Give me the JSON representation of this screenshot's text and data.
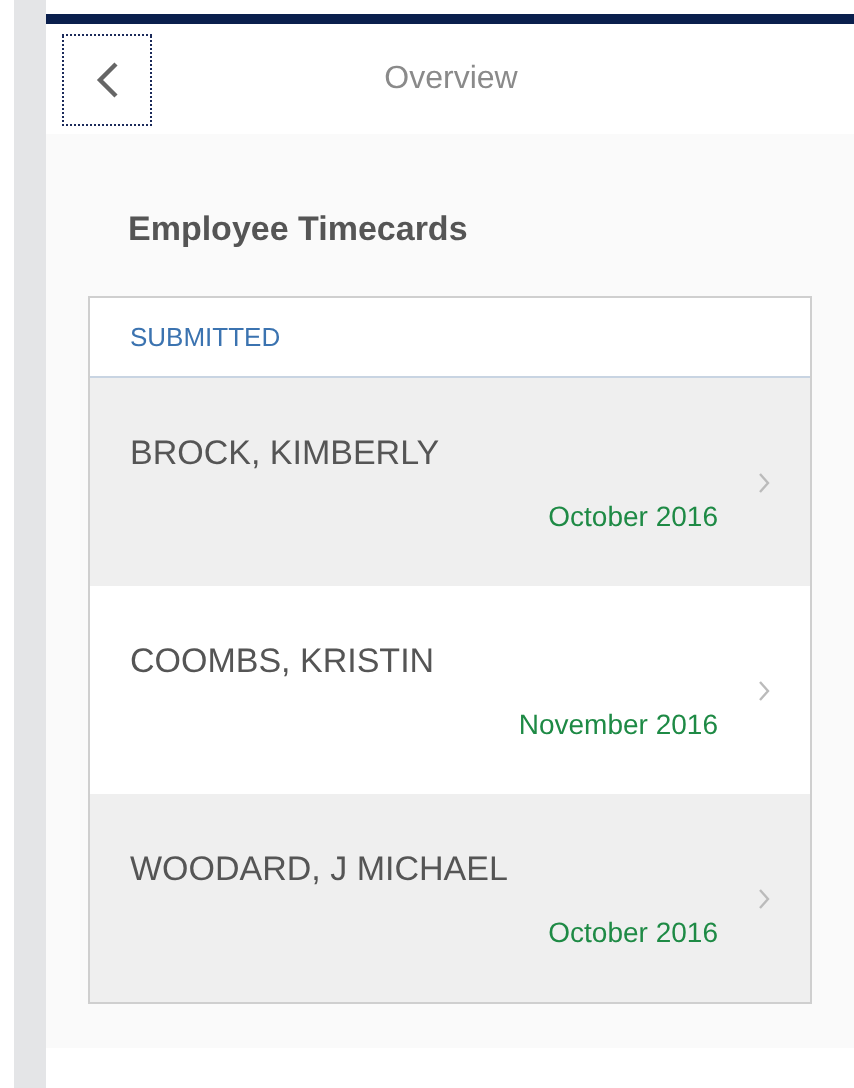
{
  "header": {
    "title": "Overview"
  },
  "section_title": "Employee Timecards",
  "list": {
    "group": "SUBMITTED",
    "items": [
      {
        "name": "BROCK, KIMBERLY",
        "period": "October 2016"
      },
      {
        "name": "COOMBS, KRISTIN",
        "period": "November 2016"
      },
      {
        "name": "WOODARD, J MICHAEL",
        "period": "October 2016"
      }
    ]
  }
}
